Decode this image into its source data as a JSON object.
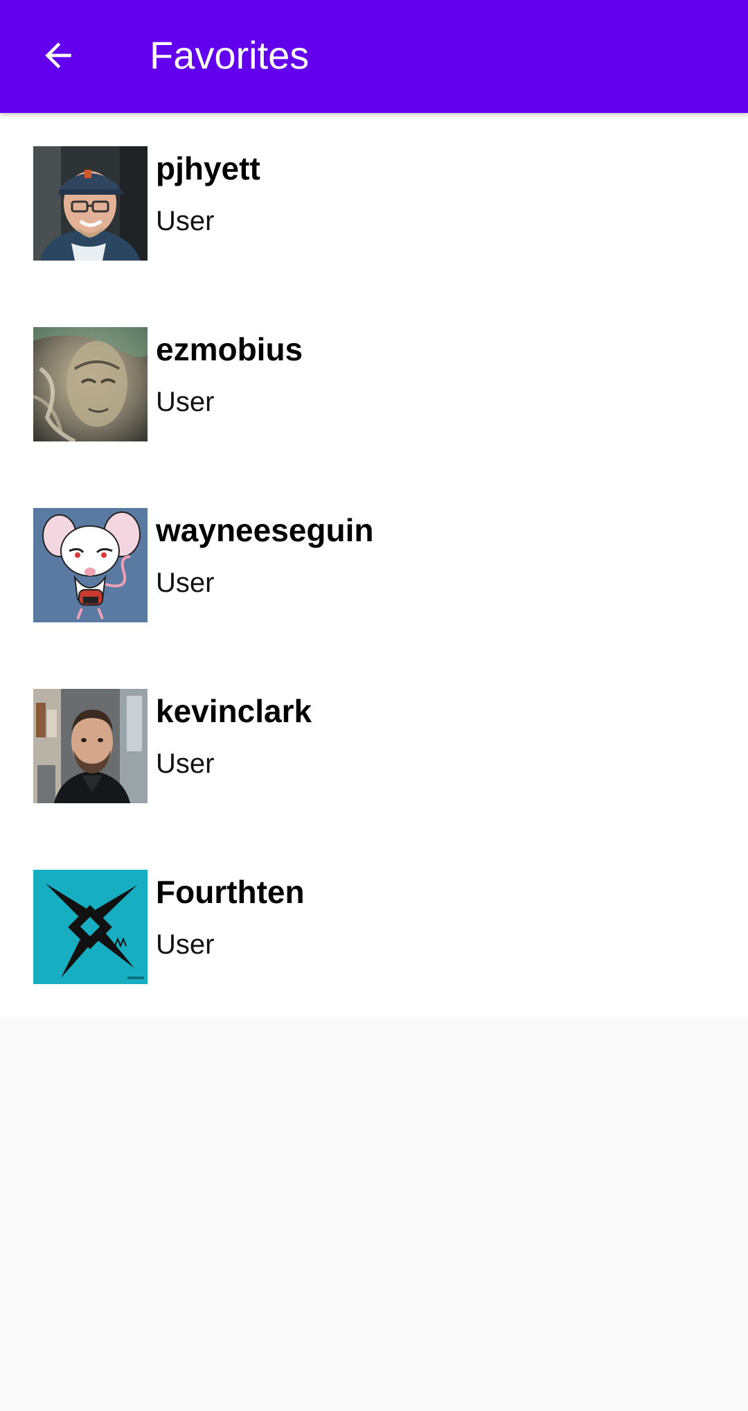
{
  "app_bar": {
    "title": "Favorites",
    "back_icon": "arrow-back-icon",
    "color": "#6200ee"
  },
  "favorites": [
    {
      "username": "pjhyett",
      "type": "User",
      "avatar": "photo-man-cap-glasses"
    },
    {
      "username": "ezmobius",
      "type": "User",
      "avatar": "art-alien-face"
    },
    {
      "username": "wayneeseguin",
      "type": "User",
      "avatar": "cartoon-mouse-brain"
    },
    {
      "username": "kevinclark",
      "type": "User",
      "avatar": "photo-bearded-man"
    },
    {
      "username": "Fourthten",
      "type": "User",
      "avatar": "logo-black-star-cyan"
    }
  ]
}
